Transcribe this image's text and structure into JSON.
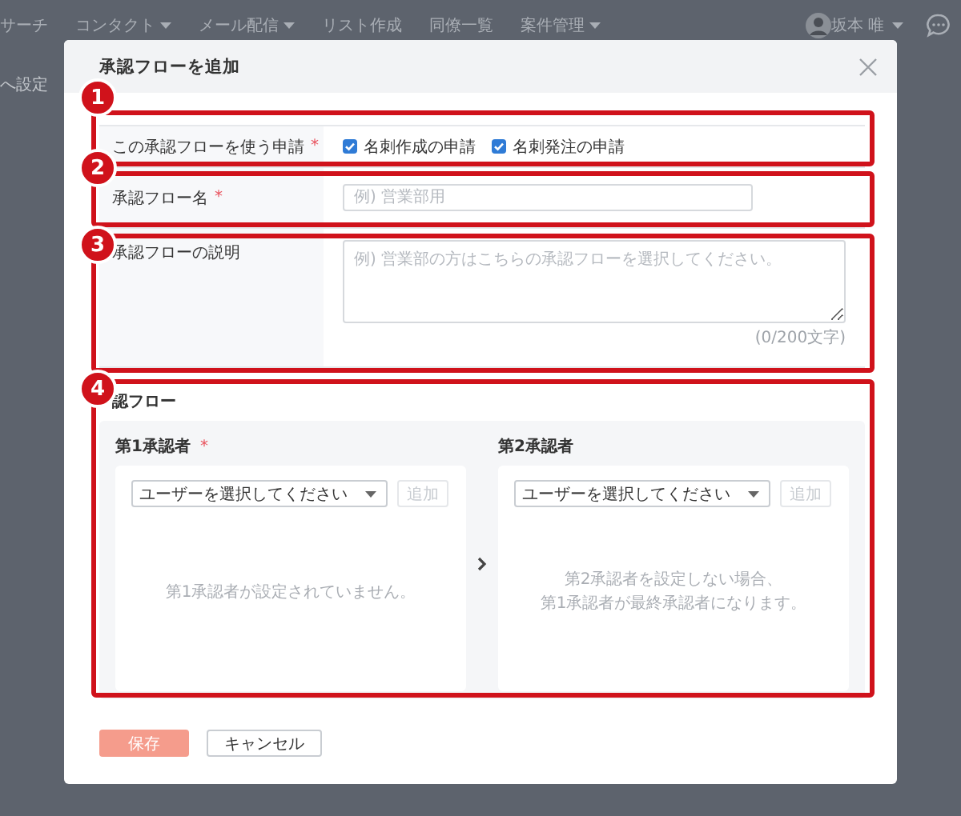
{
  "nav": {
    "items": [
      {
        "label": "サーチ",
        "dropdown": false
      },
      {
        "label": "コンタクト",
        "dropdown": true
      },
      {
        "label": "メール配信",
        "dropdown": true
      },
      {
        "label": "リスト作成",
        "dropdown": false
      },
      {
        "label": "同僚一覧",
        "dropdown": false
      },
      {
        "label": "案件管理",
        "dropdown": true
      }
    ],
    "user": {
      "name": "坂本 唯",
      "dropdown": true
    }
  },
  "page": {
    "breadcrumb": "へ設定"
  },
  "dialog": {
    "title": "承認フローを追加",
    "fields": [
      {
        "kind": "checkboxes",
        "label": "この承認フローを使う申請",
        "required_mark": "*",
        "options": [
          {
            "label": "名刺作成の申請",
            "checked": true
          },
          {
            "label": "名刺発注の申請",
            "checked": true
          }
        ]
      },
      {
        "kind": "text",
        "label": "承認フロー名",
        "required_mark": "*",
        "placeholder": "例) 営業部用"
      },
      {
        "kind": "textarea",
        "label": "承認フローの説明",
        "placeholder": "例) 営業部の方はこちらの承認フローを選択してください。",
        "counter": "(0/200文字)"
      }
    ],
    "flow": {
      "title": "認フロー",
      "approvers": [
        {
          "label": "第1承認者",
          "required_mark": "*",
          "select_placeholder": "ユーザーを選択してください",
          "add_button": "追加",
          "empty_message": [
            "第1承認者が設定されていません。"
          ]
        },
        {
          "label": "第2承認者",
          "select_placeholder": "ユーザーを選択してください",
          "add_button": "追加",
          "empty_message": [
            "第2承認者を設定しない場合、",
            "第1承認者が最終承認者になります。"
          ]
        }
      ]
    },
    "buttons": [
      {
        "label": "保存",
        "disabled": true
      },
      {
        "label": "キャンセル",
        "disabled": false
      }
    ]
  },
  "callouts": [
    {
      "number": "1"
    },
    {
      "number": "2"
    },
    {
      "number": "3"
    },
    {
      "number": "4"
    }
  ]
}
